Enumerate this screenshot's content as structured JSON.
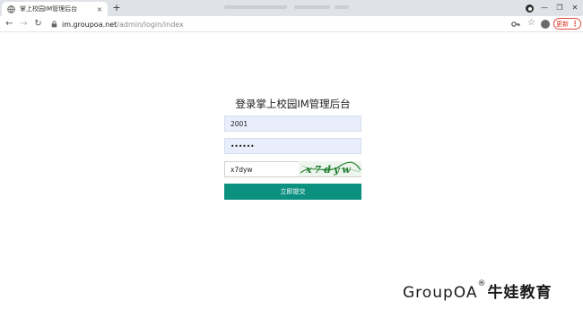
{
  "browser": {
    "tab_title": "掌上校园IM管理后台",
    "tab_close": "×",
    "new_tab": "+",
    "url_host": "im.groupoa.net",
    "url_path": "/admin/login/index",
    "update_label": "更新",
    "update_menu": "⋮",
    "win_minimize": "—",
    "win_restore": "❐",
    "win_close": "✕"
  },
  "login": {
    "title": "登录掌上校园IM管理后台",
    "username_value": "2001",
    "password_value": "••••••",
    "captcha_input_value": "x7dyw",
    "captcha_text": "x7dyw",
    "submit_label": "立即提交"
  },
  "watermark": {
    "brand": "GroupOA",
    "registered": "®",
    "cn_name": "牛娃教育"
  },
  "colors": {
    "submit_bg": "#0c9080",
    "input_bg": "#e8eefb",
    "update_red": "#d93025"
  }
}
